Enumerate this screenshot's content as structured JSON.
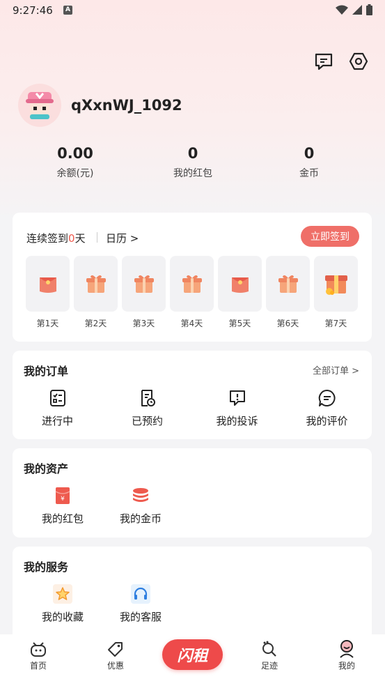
{
  "status_bar": {
    "time": "9:27:46",
    "badge": "A"
  },
  "profile": {
    "username": "qXxnWJ_1092"
  },
  "stats": [
    {
      "value": "0.00",
      "label": "余额(元)"
    },
    {
      "value": "0",
      "label": "我的红包"
    },
    {
      "value": "0",
      "label": "金币"
    }
  ],
  "checkin": {
    "prefix": "连续签到",
    "days": "0",
    "suffix": "天",
    "calendar": "日历",
    "calendar_chevron": ">",
    "button": "立即签到",
    "day_labels": [
      "第1天",
      "第2天",
      "第3天",
      "第4天",
      "第5天",
      "第6天",
      "第7天"
    ],
    "day_icons": [
      "red-envelope-icon",
      "gift-icon",
      "gift-icon",
      "gift-icon",
      "red-envelope-icon",
      "gift-icon",
      "big-gift-icon"
    ]
  },
  "orders": {
    "title": "我的订单",
    "all_link": "全部订单 >",
    "items": [
      "进行中",
      "已预约",
      "我的投诉",
      "我的评价"
    ]
  },
  "assets": {
    "title": "我的资产",
    "items": [
      "我的红包",
      "我的金币"
    ]
  },
  "services": {
    "title": "我的服务",
    "items": [
      "我的收藏",
      "我的客服"
    ]
  },
  "tabbar": {
    "items": [
      "首页",
      "优惠",
      "足迹",
      "我的"
    ],
    "center_logo": "闪租"
  },
  "colors": {
    "accent": "#ef5a4e",
    "checkin_button": "#ef6f68",
    "center_tab": "#ee4a4a"
  }
}
